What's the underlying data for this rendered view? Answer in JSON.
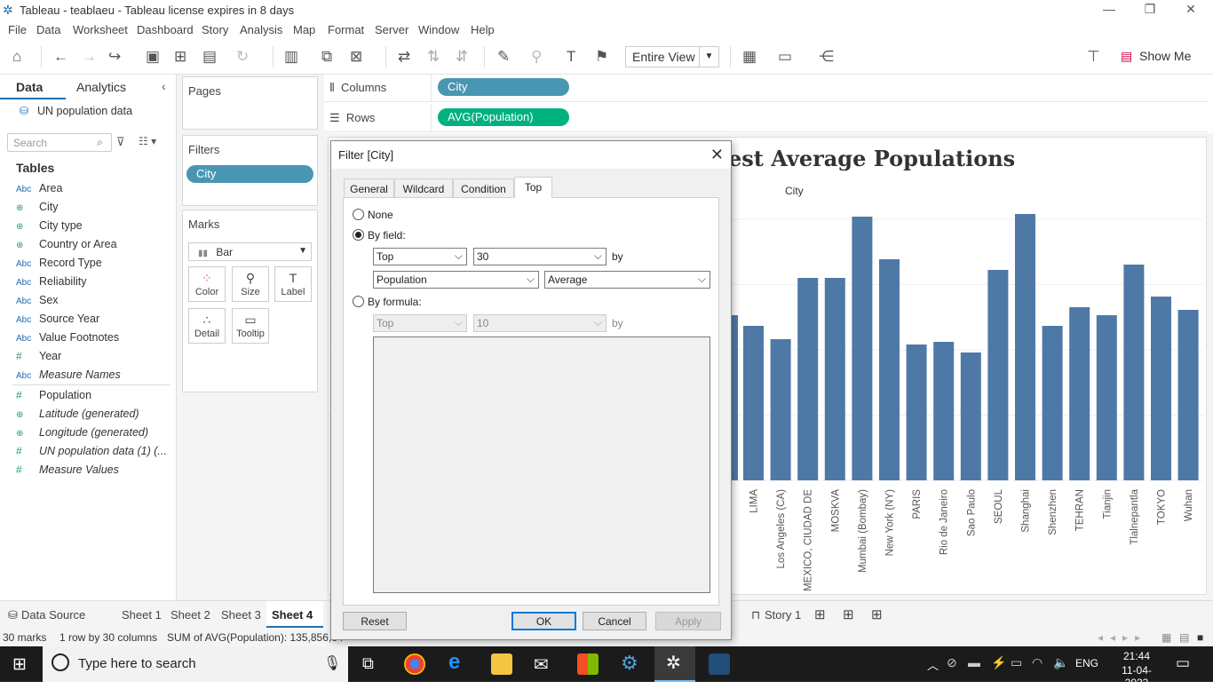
{
  "window": {
    "title": "Tableau - teablaeu - Tableau license expires in 8 days"
  },
  "menu": [
    "File",
    "Data",
    "Worksheet",
    "Dashboard",
    "Story",
    "Analysis",
    "Map",
    "Format",
    "Server",
    "Window",
    "Help"
  ],
  "toolbar": {
    "fit_value": "Entire View",
    "show_me": "Show Me"
  },
  "data_pane": {
    "tab_data": "Data",
    "tab_analytics": "Analytics",
    "source": "UN population data",
    "search_placeholder": "Search",
    "tables_label": "Tables",
    "fields": [
      {
        "type": "Abc",
        "name": "Area"
      },
      {
        "type": "geo",
        "name": "City"
      },
      {
        "type": "geo",
        "name": "City type"
      },
      {
        "type": "geo",
        "name": "Country or Area"
      },
      {
        "type": "Abc",
        "name": "Record Type"
      },
      {
        "type": "Abc",
        "name": "Reliability"
      },
      {
        "type": "Abc",
        "name": "Sex"
      },
      {
        "type": "Abc",
        "name": "Source Year"
      },
      {
        "type": "Abc",
        "name": "Value Footnotes"
      },
      {
        "type": "#",
        "name": "Year"
      },
      {
        "type": "Abc",
        "name": "Measure Names"
      },
      {
        "type": "#",
        "name": "Population"
      },
      {
        "type": "geo",
        "name": "Latitude (generated)"
      },
      {
        "type": "geo",
        "name": "Longitude (generated)"
      },
      {
        "type": "#",
        "name": "UN population data (1) (..."
      },
      {
        "type": "#",
        "name": "Measure Values"
      }
    ]
  },
  "cards": {
    "pages": "Pages",
    "filters": "Filters",
    "filter_pill": "City",
    "marks": "Marks",
    "mark_type": "Bar",
    "mark_buttons": [
      "Color",
      "Size",
      "Label",
      "Detail",
      "Tooltip"
    ]
  },
  "shelves": {
    "columns_label": "Columns",
    "columns_pill": "City",
    "rows_label": "Rows",
    "rows_pill": "AVG(Population)"
  },
  "chart_data": {
    "type": "bar",
    "title": "est Average Populations",
    "xlabel": "City",
    "color": "#4e79a7",
    "categories": [
      "LIMA",
      "Los Angeles (CA)",
      "MEXICO, CIUDAD DE",
      "MOSKVA",
      "Mumbai (Bombay)",
      "New York (NY)",
      "PARIS",
      "Rio de Janeiro",
      "Sao Paulo",
      "SEOUL",
      "Shanghai",
      "Shenzhen",
      "TEHRAN",
      "Tianjin",
      "Tlalnepantla",
      "TOKYO",
      "Wuhan"
    ],
    "values": [
      58,
      53,
      76,
      76,
      99,
      83,
      51,
      52,
      48,
      79,
      100,
      58,
      65,
      62,
      81,
      69,
      64
    ],
    "partial_first_bar": 62
  },
  "dialog": {
    "title": "Filter [City]",
    "tabs": [
      "General",
      "Wildcard",
      "Condition",
      "Top"
    ],
    "active_tab": "Top",
    "none_label": "None",
    "by_field_label": "By field:",
    "top_value": "Top",
    "n_value": "30",
    "by_text": "by",
    "field_value": "Population",
    "agg_value": "Average",
    "by_formula_label": "By formula:",
    "formula_top": "Top",
    "formula_n": "10",
    "buttons": {
      "reset": "Reset",
      "ok": "OK",
      "cancel": "Cancel",
      "apply": "Apply"
    }
  },
  "sheet_tabs": {
    "data_source": "Data Source",
    "sheets": [
      "Sheet 1",
      "Sheet 2",
      "Sheet 3",
      "Sheet 4"
    ],
    "active": "Sheet 4",
    "story": "Story 1"
  },
  "status": {
    "marks": "30 marks",
    "dims": "1 row by 30 columns",
    "sum": "SUM of AVG(Population): 135,856,34"
  },
  "taskbar": {
    "search_placeholder": "Type here to search",
    "lang": "ENG",
    "time": "21:44",
    "date": "11-04-2023"
  }
}
